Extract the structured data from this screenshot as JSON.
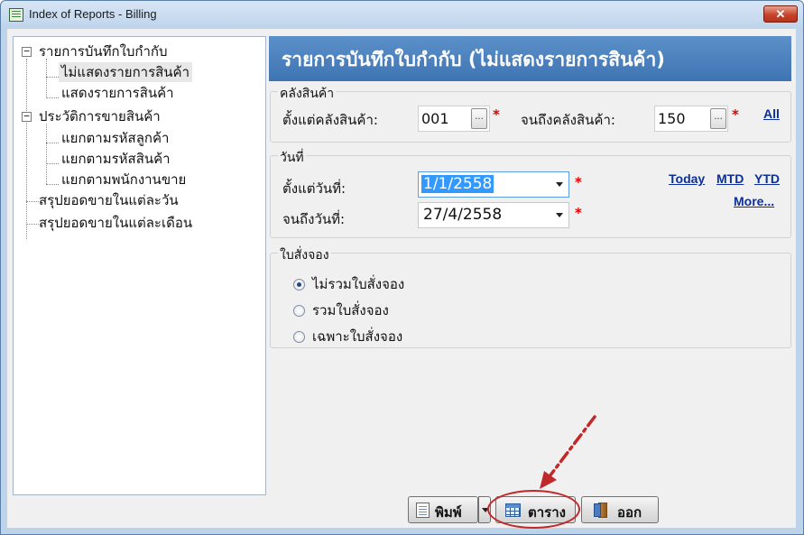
{
  "window": {
    "title": "Index of Reports - Billing",
    "close_label": "✕"
  },
  "tree": {
    "groups": [
      {
        "label": "รายการบันทึกใบกำกับ",
        "expander": "−",
        "children": [
          "ไม่แสดงรายการสินค้า",
          "แสดงรายการสินค้า"
        ]
      },
      {
        "label": "ประวัติการขายสินค้า",
        "expander": "−",
        "children": [
          "แยกตามรหัสลูกค้า",
          "แยกตามรหัสสินค้า",
          "แยกตามพนักงานขาย"
        ]
      }
    ],
    "leaves": [
      "สรุปยอดขายในแต่ละวัน",
      "สรุปยอดขายในแต่ละเดือน"
    ],
    "selected": "ไม่แสดงรายการสินค้า"
  },
  "header": {
    "title": "รายการบันทึกใบกำกับ (ไม่แสดงรายการสินค้า)"
  },
  "warehouse": {
    "group_title": "คลังสินค้า",
    "from_label": "ตั้งแต่คลังสินค้า:",
    "from_value": "001",
    "to_label": "จนถึงคลังสินค้า:",
    "to_value": "150",
    "browse_label": "...",
    "required_mark": "*",
    "all_link": "All"
  },
  "date": {
    "group_title": "วันที่",
    "from_label": "ตั้งแต่วันที่:",
    "from_value": "1/1/2558",
    "to_label": "จนถึงวันที่:",
    "to_value": "27/4/2558",
    "required_mark": "*",
    "links": {
      "today": "Today",
      "mtd": "MTD",
      "ytd": "YTD",
      "more": "More..."
    }
  },
  "orders": {
    "group_title": "ใบสั่งจอง",
    "options": [
      "ไม่รวมใบสั่งจอง",
      "รวมใบสั่งจอง",
      "เฉพาะใบสั่งจอง"
    ],
    "selected_index": 0
  },
  "buttons": {
    "print": "พิมพ์",
    "table": "ตาราง",
    "exit": "ออก"
  },
  "colors": {
    "banner": "#4a80c0",
    "annotation": "#c0282a",
    "link": "#0c2f9a"
  }
}
